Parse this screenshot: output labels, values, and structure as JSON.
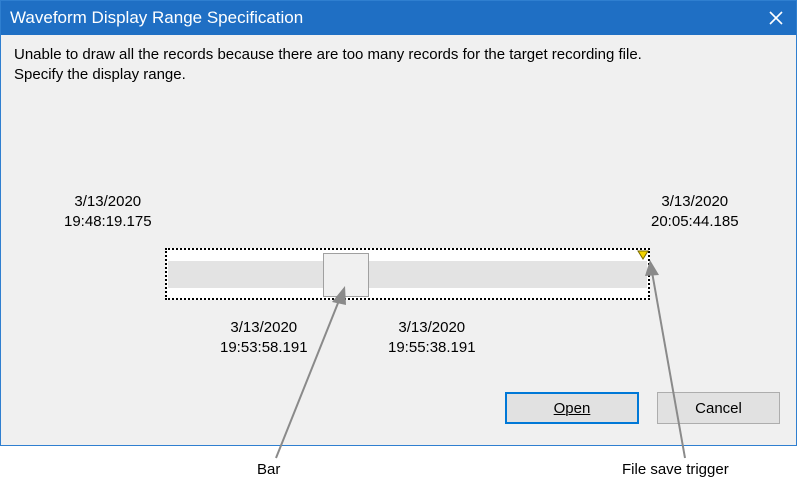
{
  "dialog": {
    "title": "Waveform Display Range Specification",
    "close_icon": "close-icon",
    "message_line1": "Unable to draw all the records because there are too many records for the target recording file.",
    "message_line2": "Specify the display range."
  },
  "range": {
    "start": {
      "date": "3/13/2020",
      "time": "19:48:19.175"
    },
    "end": {
      "date": "3/13/2020",
      "time": "20:05:44.185"
    },
    "window_start": {
      "date": "3/13/2020",
      "time": "19:53:58.191"
    },
    "window_end": {
      "date": "3/13/2020",
      "time": "19:55:38.191"
    },
    "trigger_icon": "file-save-trigger-icon",
    "trigger_color": "#f2d400"
  },
  "buttons": {
    "open_label": "Open",
    "cancel_label": "Cancel"
  },
  "annotations": {
    "bar": "Bar",
    "file_save_trigger": "File save trigger"
  },
  "colors": {
    "title_bar": "#1f6fc4",
    "dialog_bg": "#f0f0f0",
    "focus_border": "#0078d7"
  }
}
